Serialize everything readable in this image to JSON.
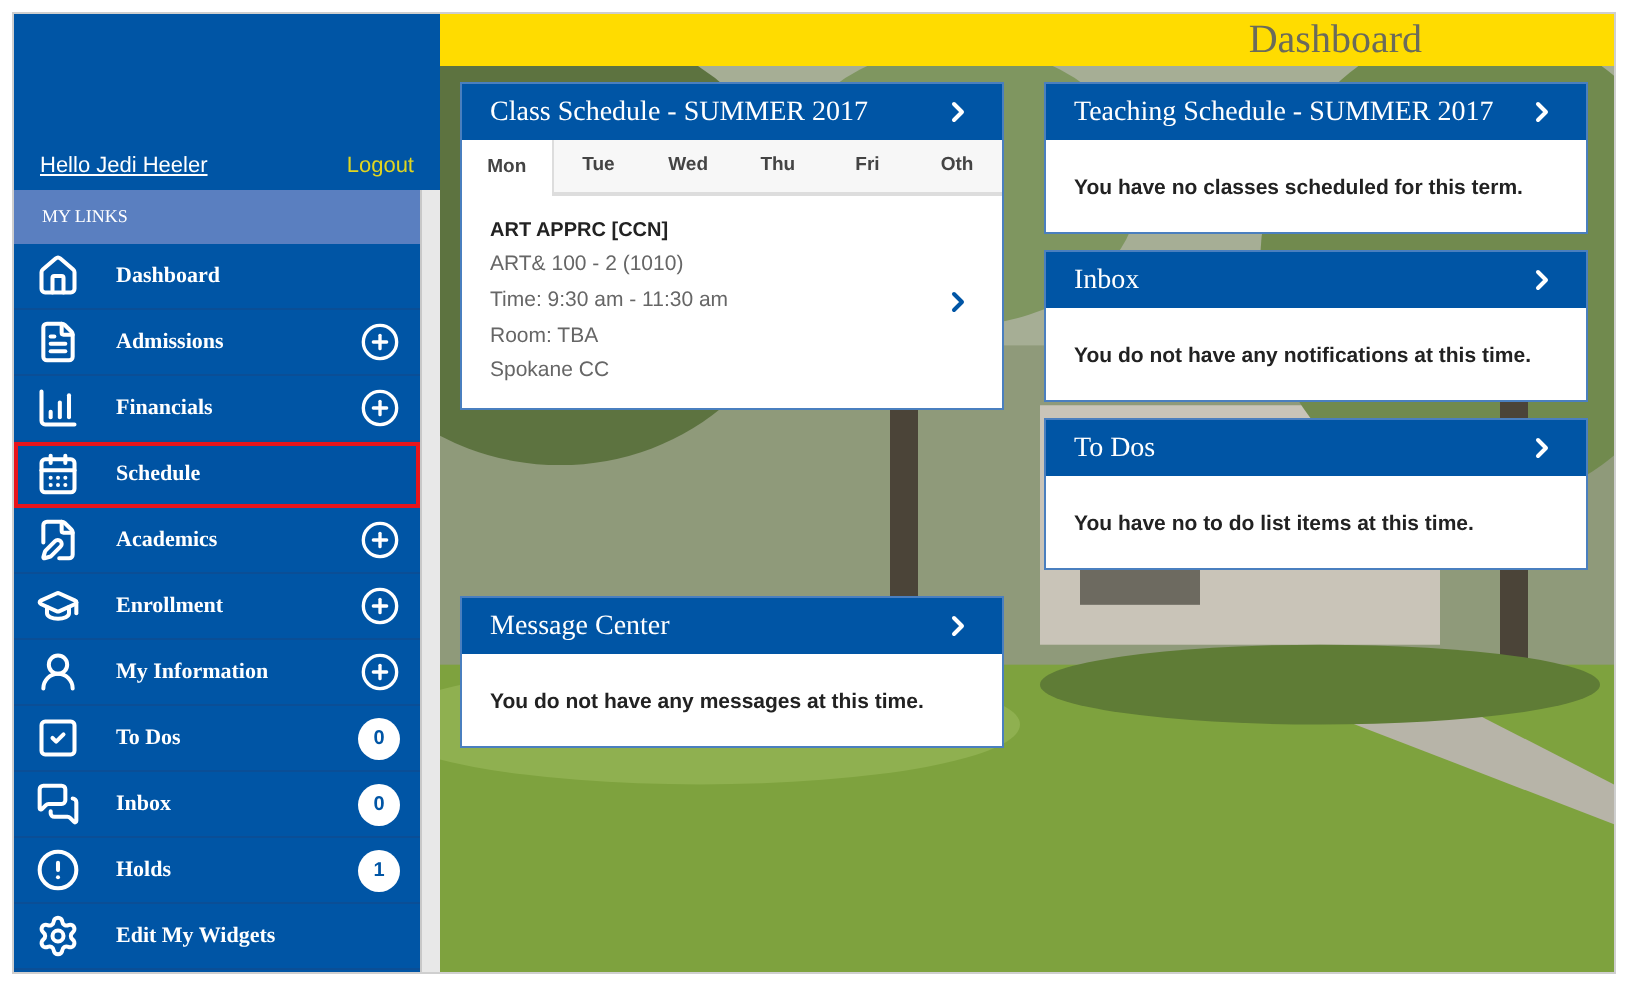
{
  "user": {
    "greeting": "Hello Jedi Heeler",
    "logout": "Logout"
  },
  "sidebar": {
    "heading": "MY LINKS",
    "items": [
      {
        "label": "Dashboard",
        "kind": "plain",
        "selected": false
      },
      {
        "label": "Admissions",
        "kind": "expand",
        "selected": false
      },
      {
        "label": "Financials",
        "kind": "expand",
        "selected": false
      },
      {
        "label": "Schedule",
        "kind": "plain",
        "selected": true
      },
      {
        "label": "Academics",
        "kind": "expand",
        "selected": false
      },
      {
        "label": "Enrollment",
        "kind": "expand",
        "selected": false
      },
      {
        "label": "My Information",
        "kind": "expand",
        "selected": false
      },
      {
        "label": "To Dos",
        "kind": "count",
        "count": "0",
        "selected": false
      },
      {
        "label": "Inbox",
        "kind": "count",
        "count": "0",
        "selected": false
      },
      {
        "label": "Holds",
        "kind": "count",
        "count": "1",
        "selected": false
      },
      {
        "label": "Edit My Widgets",
        "kind": "plain",
        "selected": false
      }
    ]
  },
  "page_title": "Dashboard",
  "class_schedule": {
    "title": "Class Schedule - SUMMER 2017",
    "tabs": [
      {
        "label": "Mon",
        "selected": true
      },
      {
        "label": "Tue",
        "selected": false
      },
      {
        "label": "Wed",
        "selected": false
      },
      {
        "label": "Thu",
        "selected": false
      },
      {
        "label": "Fri",
        "selected": false
      },
      {
        "label": "Oth",
        "selected": false
      }
    ],
    "course": {
      "name": "ART APPRC [CCN]",
      "lines": [
        "ART& 100 - 2 (1010)",
        "Time: 9:30 am - 11:30 am",
        "Room: TBA",
        "Spokane CC"
      ]
    }
  },
  "message_center": {
    "title": "Message Center",
    "message": "You do not have any messages at this time."
  },
  "right_widgets": [
    {
      "title": "Teaching Schedule - SUMMER 2017",
      "message": "You have no classes scheduled for this term."
    },
    {
      "title": "Inbox",
      "message": "You do not have any notifications at this time."
    },
    {
      "title": "To Dos",
      "message": "You have no to do list items at this time."
    }
  ]
}
